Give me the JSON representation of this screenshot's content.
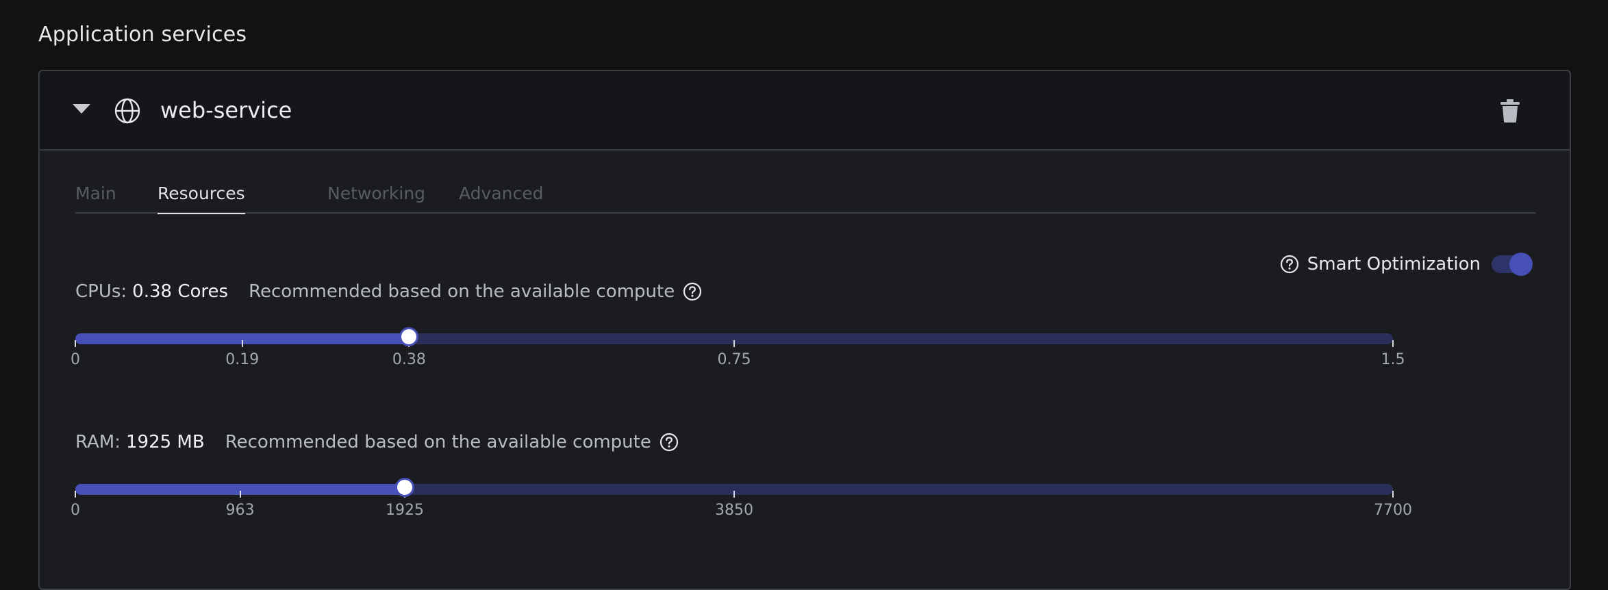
{
  "section_title": "Application services",
  "service": {
    "name": "web-service",
    "icons": {
      "collapse": "chevron-down-icon",
      "type": "globe-icon",
      "delete": "trash-icon"
    }
  },
  "tabs": [
    {
      "label": "Main",
      "active": false
    },
    {
      "label": "Resources",
      "active": true
    },
    {
      "label": "Networking",
      "active": false
    },
    {
      "label": "Advanced",
      "active": false
    }
  ],
  "smart_optimization": {
    "label": "Smart Optimization",
    "enabled": true
  },
  "cpu": {
    "label": "CPUs:",
    "value": "0.38 Cores",
    "hint": "Recommended based on the available compute",
    "min": 0,
    "max": 1.5,
    "current": 0.38,
    "ticks": [
      {
        "value": 0,
        "label": "0"
      },
      {
        "value": 0.19,
        "label": "0.19"
      },
      {
        "value": 0.38,
        "label": "0.38"
      },
      {
        "value": 0.75,
        "label": "0.75"
      },
      {
        "value": 1.5,
        "label": "1.5"
      }
    ]
  },
  "ram": {
    "label": "RAM:",
    "value": "1925 MB",
    "hint": "Recommended based on the available compute",
    "min": 0,
    "max": 7700,
    "current": 1925,
    "ticks": [
      {
        "value": 0,
        "label": "0"
      },
      {
        "value": 963,
        "label": "963"
      },
      {
        "value": 1925,
        "label": "1925"
      },
      {
        "value": 3850,
        "label": "3850"
      },
      {
        "value": 7700,
        "label": "7700"
      }
    ]
  },
  "colors": {
    "accent": "#4650b7",
    "track": "#292e5a",
    "background": "#121213",
    "card": "#1a1c20"
  }
}
